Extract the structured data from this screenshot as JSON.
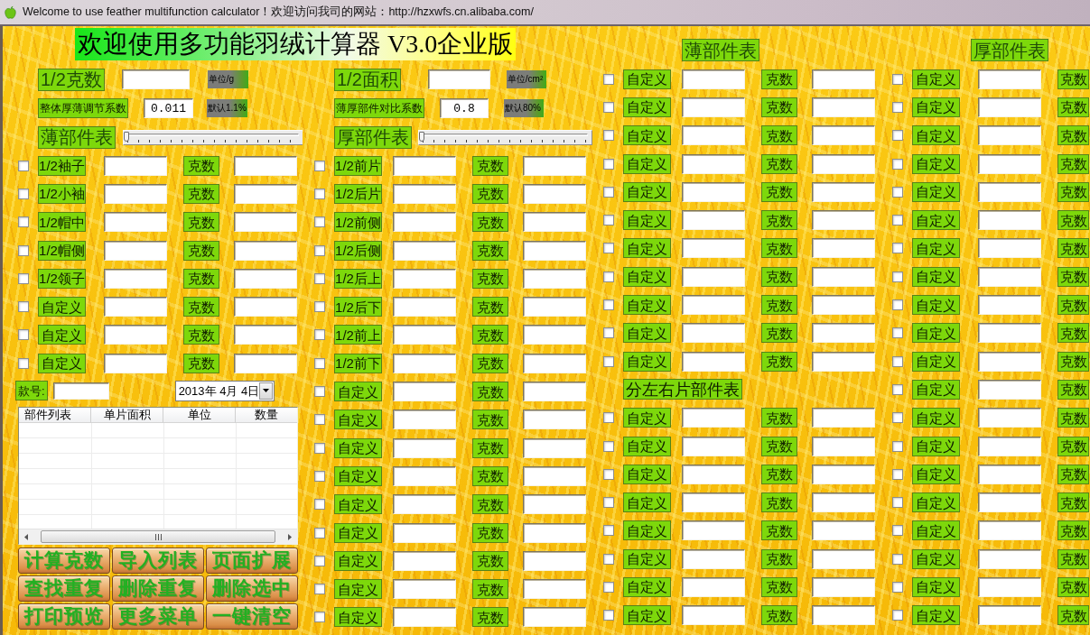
{
  "window": {
    "title": "Welcome to use feather multifunction calculator！欢迎访问我司的网站：http://hzxwfs.cn.alibaba.com/"
  },
  "banner": "欢迎使用多功能羽绒计算器 V3.0企业版",
  "panels": [
    {
      "settings": [
        {
          "label": "1/2克数",
          "unit": "单位/g"
        },
        {
          "label": "整体厚薄调节系数",
          "value": "0.011",
          "unit": "默认1.1%"
        }
      ],
      "table_title": "薄部件表",
      "slider": {
        "level": 0
      },
      "rows": [
        {
          "checked": false,
          "label": "1/2袖子",
          "weight_label": "克数"
        },
        {
          "checked": false,
          "label": "1/2小袖",
          "weight_label": "克数"
        },
        {
          "checked": false,
          "label": "1/2帽中",
          "weight_label": "克数"
        },
        {
          "checked": false,
          "label": "1/2帽侧",
          "weight_label": "克数"
        },
        {
          "checked": false,
          "label": "1/2领子",
          "weight_label": "克数"
        },
        {
          "checked": false,
          "label": "自定义",
          "weight_label": "克数"
        },
        {
          "checked": false,
          "label": "自定义",
          "weight_label": "克数"
        },
        {
          "checked": false,
          "label": "自定义",
          "weight_label": "克数"
        }
      ]
    },
    {
      "settings": [
        {
          "label": "1/2面积",
          "unit": "单位/cm²"
        },
        {
          "label": "薄厚部件对比系数",
          "value": "0.8",
          "unit": "默认80%"
        }
      ],
      "table_title": "厚部件表",
      "slider": {
        "level": 0
      },
      "rows": [
        {
          "checked": false,
          "label": "1/2前片",
          "weight_label": "克数"
        },
        {
          "checked": false,
          "label": "1/2后片",
          "weight_label": "克数"
        },
        {
          "checked": false,
          "label": "1/2前侧",
          "weight_label": "克数"
        },
        {
          "checked": false,
          "label": "1/2后侧",
          "weight_label": "克数"
        },
        {
          "checked": false,
          "label": "1/2后上",
          "weight_label": "克数"
        },
        {
          "checked": false,
          "label": "1/2后下",
          "weight_label": "克数"
        },
        {
          "checked": false,
          "label": "1/2前上",
          "weight_label": "克数"
        },
        {
          "checked": false,
          "label": "1/2前下",
          "weight_label": "克数"
        },
        {
          "checked": false,
          "label": "自定义",
          "weight_label": "克数"
        },
        {
          "checked": false,
          "label": "自定义",
          "weight_label": "克数"
        },
        {
          "checked": false,
          "label": "自定义",
          "weight_label": "克数"
        },
        {
          "checked": false,
          "label": "自定义",
          "weight_label": "克数"
        },
        {
          "checked": false,
          "label": "自定义",
          "weight_label": "克数"
        },
        {
          "checked": false,
          "label": "自定义",
          "weight_label": "克数"
        },
        {
          "checked": false,
          "label": "自定义",
          "weight_label": "克数"
        },
        {
          "checked": false,
          "label": "自定义",
          "weight_label": "克数"
        },
        {
          "checked": false,
          "label": "自定义",
          "weight_label": "克数"
        }
      ]
    },
    {
      "title": "薄部件表",
      "rows": [
        {
          "kind": "part",
          "checked": false,
          "label": "自定义",
          "weight_label": "克数"
        },
        {
          "kind": "part",
          "checked": false,
          "label": "自定义",
          "weight_label": "克数"
        },
        {
          "kind": "part",
          "checked": false,
          "label": "自定义",
          "weight_label": "克数"
        },
        {
          "kind": "part",
          "checked": false,
          "label": "自定义",
          "weight_label": "克数"
        },
        {
          "kind": "part",
          "checked": false,
          "label": "自定义",
          "weight_label": "克数"
        },
        {
          "kind": "part",
          "checked": false,
          "label": "自定义",
          "weight_label": "克数"
        },
        {
          "kind": "part",
          "checked": false,
          "label": "自定义",
          "weight_label": "克数"
        },
        {
          "kind": "part",
          "checked": false,
          "label": "自定义",
          "weight_label": "克数"
        },
        {
          "kind": "part",
          "checked": false,
          "label": "自定义",
          "weight_label": "克数"
        },
        {
          "kind": "part",
          "checked": false,
          "label": "自定义",
          "weight_label": "克数"
        },
        {
          "kind": "part",
          "checked": false,
          "label": "自定义",
          "weight_label": "克数"
        },
        {
          "kind": "heading",
          "text": "分左右片部件表"
        },
        {
          "kind": "part",
          "checked": false,
          "label": "自定义",
          "weight_label": "克数"
        },
        {
          "kind": "part",
          "checked": false,
          "label": "自定义",
          "weight_label": "克数"
        },
        {
          "kind": "part",
          "checked": false,
          "label": "自定义",
          "weight_label": "克数"
        },
        {
          "kind": "part",
          "checked": false,
          "label": "自定义",
          "weight_label": "克数"
        },
        {
          "kind": "part",
          "checked": false,
          "label": "自定义",
          "weight_label": "克数"
        },
        {
          "kind": "part",
          "checked": false,
          "label": "自定义",
          "weight_label": "克数"
        },
        {
          "kind": "part",
          "checked": false,
          "label": "自定义",
          "weight_label": "克数"
        },
        {
          "kind": "part",
          "checked": false,
          "label": "自定义",
          "weight_label": "克数"
        }
      ]
    },
    {
      "title": "厚部件表",
      "rows": [
        {
          "checked": false,
          "label": "自定义",
          "weight_label": "克数"
        },
        {
          "checked": false,
          "label": "自定义",
          "weight_label": "克数"
        },
        {
          "checked": false,
          "label": "自定义",
          "weight_label": "克数"
        },
        {
          "checked": false,
          "label": "自定义",
          "weight_label": "克数"
        },
        {
          "checked": false,
          "label": "自定义",
          "weight_label": "克数"
        },
        {
          "checked": false,
          "label": "自定义",
          "weight_label": "克数"
        },
        {
          "checked": false,
          "label": "自定义",
          "weight_label": "克数"
        },
        {
          "checked": false,
          "label": "自定义",
          "weight_label": "克数"
        },
        {
          "checked": false,
          "label": "自定义",
          "weight_label": "克数"
        },
        {
          "checked": false,
          "label": "自定义",
          "weight_label": "克数"
        },
        {
          "checked": false,
          "label": "自定义",
          "weight_label": "克数"
        },
        {
          "checked": false,
          "label": "自定义",
          "weight_label": "克数"
        },
        {
          "checked": false,
          "label": "自定义",
          "weight_label": "克数"
        },
        {
          "checked": false,
          "label": "自定义",
          "weight_label": "克数"
        },
        {
          "checked": false,
          "label": "自定义",
          "weight_label": "克数"
        },
        {
          "checked": false,
          "label": "自定义",
          "weight_label": "克数"
        },
        {
          "checked": false,
          "label": "自定义",
          "weight_label": "克数"
        },
        {
          "checked": false,
          "label": "自定义",
          "weight_label": "克数"
        },
        {
          "checked": false,
          "label": "自定义",
          "weight_label": "克数"
        },
        {
          "checked": false,
          "label": "自定义",
          "weight_label": "克数"
        }
      ]
    }
  ],
  "style_number": {
    "label": "款号:"
  },
  "date_picker": {
    "value": "2013年 4月 4日"
  },
  "parts_list": {
    "columns": [
      "部件列表",
      "单片面积",
      "单位",
      "数量"
    ]
  },
  "buttons": [
    "计算克数",
    "导入列表",
    "页面扩展",
    "查找重复",
    "删除重复",
    "删除选中",
    "打印预览",
    "更多菜单",
    "一键清空"
  ]
}
